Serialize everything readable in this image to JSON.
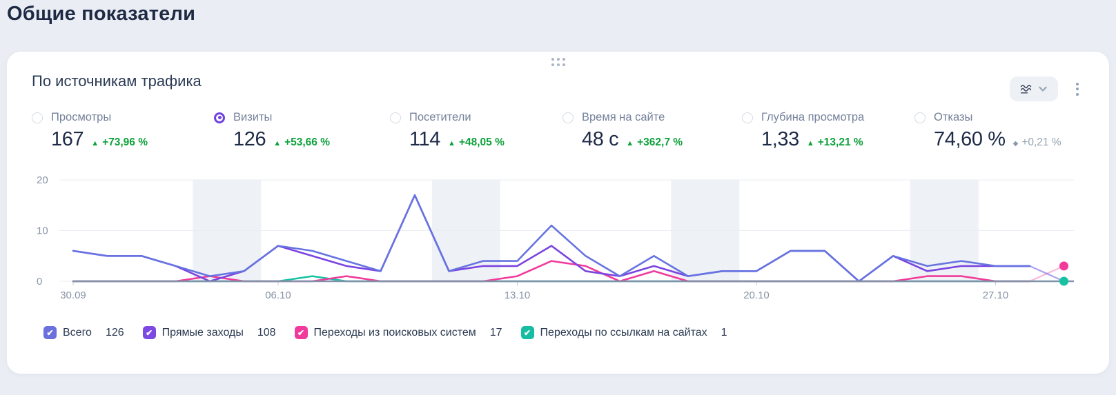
{
  "page_title": "Общие показатели",
  "card": {
    "title": "По источникам трафика",
    "icons": {
      "check": "✔",
      "up_triangle": "▲",
      "neutral_diamond": "◆"
    }
  },
  "metrics": [
    {
      "label": "Просмотры",
      "value": "167",
      "delta": "+73,96 %",
      "trend": "up",
      "selected": false
    },
    {
      "label": "Визиты",
      "value": "126",
      "delta": "+53,66 %",
      "trend": "up",
      "selected": true
    },
    {
      "label": "Посетители",
      "value": "114",
      "delta": "+48,05 %",
      "trend": "up",
      "selected": false
    },
    {
      "label": "Время на сайте",
      "value": "48 с",
      "delta": "+362,7 %",
      "trend": "up",
      "selected": false
    },
    {
      "label": "Глубина просмотра",
      "value": "1,33",
      "delta": "+13,21 %",
      "trend": "up",
      "selected": false
    },
    {
      "label": "Отказы",
      "value": "74,60 %",
      "delta": "+0,21 %",
      "trend": "neutral",
      "selected": false
    }
  ],
  "chart_data": {
    "type": "line",
    "ylim": [
      0,
      20
    ],
    "y_ticks": [
      0,
      10,
      20
    ],
    "days": 30,
    "x_tick_labels": [
      {
        "label": "30.09",
        "day": 0
      },
      {
        "label": "06.10",
        "day": 6
      },
      {
        "label": "13.10",
        "day": 13
      },
      {
        "label": "20.10",
        "day": 20
      },
      {
        "label": "27.10",
        "day": 27
      }
    ],
    "weekend_bands": [
      [
        3.5,
        5.5
      ],
      [
        10.5,
        12.5
      ],
      [
        17.5,
        19.5
      ],
      [
        24.5,
        26.5
      ]
    ],
    "partial_from_day": 28,
    "series": [
      {
        "name": "Всего",
        "total": "126",
        "color": "#6673e0",
        "values": [
          6,
          5,
          5,
          3,
          1,
          2,
          7,
          6,
          4,
          2,
          17,
          2,
          4,
          4,
          11,
          5,
          1,
          5,
          1,
          2,
          2,
          6,
          6,
          0,
          5,
          3,
          4,
          3,
          3,
          0
        ]
      },
      {
        "name": "Прямые заходы",
        "total": "108",
        "color": "#7a44e0",
        "values": [
          6,
          5,
          5,
          3,
          0,
          2,
          7,
          5,
          3,
          2,
          17,
          2,
          3,
          3,
          7,
          2,
          1,
          3,
          1,
          2,
          2,
          6,
          6,
          0,
          5,
          2,
          3,
          3,
          3,
          0
        ]
      },
      {
        "name": "Переходы из поисковых систем",
        "total": "17",
        "color": "#f13a9a",
        "values": [
          0,
          0,
          0,
          0,
          1,
          0,
          0,
          0,
          1,
          0,
          0,
          0,
          0,
          1,
          4,
          3,
          0,
          2,
          0,
          0,
          0,
          0,
          0,
          0,
          0,
          1,
          1,
          0,
          0,
          3
        ]
      },
      {
        "name": "Переходы по ссылкам на сайтах",
        "total": "1",
        "color": "#16c2a2",
        "values": [
          0,
          0,
          0,
          0,
          0,
          0,
          0,
          1,
          0,
          0,
          0,
          0,
          0,
          0,
          0,
          0,
          0,
          0,
          0,
          0,
          0,
          0,
          0,
          0,
          0,
          0,
          0,
          0,
          0,
          0
        ]
      }
    ],
    "end_dots": [
      {
        "series": 2,
        "day": 29
      },
      {
        "series": 3,
        "day": 29
      }
    ],
    "colors": {
      "band": "#eef1f6",
      "grid": "#e9edf2",
      "axis": "#8293a9",
      "tick_text": "#8794a6"
    }
  },
  "legend": [
    {
      "label": "Всего",
      "value": "126",
      "color": "#6a71dc",
      "checked": true
    },
    {
      "label": "Прямые заходы",
      "value": "108",
      "color": "#7d49e3",
      "checked": true
    },
    {
      "label": "Переходы из поисковых систем",
      "value": "17",
      "color": "#f13a9a",
      "checked": true
    },
    {
      "label": "Переходы по ссылкам на сайтах",
      "value": "1",
      "color": "#16bda0",
      "checked": true
    }
  ]
}
